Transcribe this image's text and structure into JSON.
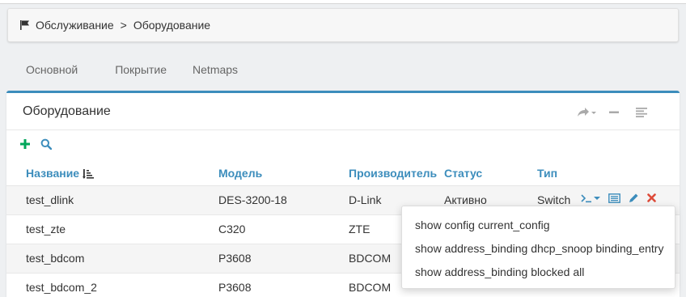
{
  "breadcrumb": {
    "icon": "flag-icon",
    "items": [
      "Обслуживание",
      "Оборудование"
    ],
    "separator": ">"
  },
  "tabs": [
    {
      "label": "Основной"
    },
    {
      "label": "Покрытие"
    },
    {
      "label": "Netmaps"
    }
  ],
  "panel": {
    "title": "Оборудование",
    "tools": [
      "share-icon",
      "minimize-icon",
      "list-icon"
    ]
  },
  "actions": [
    "add-icon",
    "search-icon"
  ],
  "table": {
    "headers": [
      "Название",
      "Модель",
      "Производитель",
      "Статус",
      "Тип"
    ],
    "rows": [
      [
        "test_dlink",
        "DES-3200-18",
        "D-Link",
        "Активно",
        "Switch"
      ],
      [
        "test_zte",
        "C320",
        "ZTE",
        "",
        ""
      ],
      [
        "test_bdcom",
        "P3608",
        "BDCOM",
        "",
        ""
      ],
      [
        "test_bdcom_2",
        "P3608",
        "BDCOM",
        "",
        ""
      ]
    ]
  },
  "row_tools": [
    "terminal-icon",
    "caret-down-icon",
    "list-box-icon",
    "edit-pencil-icon",
    "delete-icon"
  ],
  "dropdown": {
    "items": [
      "show config current_config",
      "show address_binding dhcp_snoop binding_entry",
      "show address_binding blocked all"
    ]
  },
  "colors": {
    "accent": "#3c8dbc",
    "add": "#00a65a",
    "delete": "#dd4b39"
  }
}
